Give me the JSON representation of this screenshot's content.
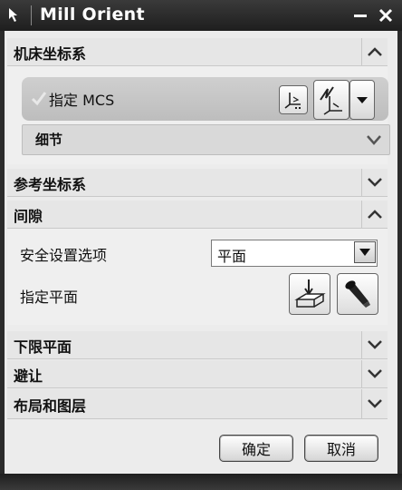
{
  "window": {
    "title": "Mill Orient",
    "icon": "pointer-arrow-icon",
    "controls": {
      "minimize": "minimize-icon",
      "close": "close-icon"
    }
  },
  "sections": {
    "machine_csys": {
      "title": "机床坐标系",
      "state": "expanded",
      "specify_mcs_label": "指定 MCS",
      "detail_label": "细节"
    },
    "reference_csys": {
      "title": "参考坐标系",
      "state": "collapsed"
    },
    "clearance": {
      "title": "间隙",
      "state": "expanded",
      "safety_option_label": "安全设置选项",
      "safety_option_value": "平面",
      "specify_plane_label": "指定平面"
    },
    "lower_plane": {
      "title": "下限平面",
      "state": "collapsed"
    },
    "avoidance": {
      "title": "避让",
      "state": "collapsed"
    },
    "layout_layers": {
      "title": "布局和图层",
      "state": "collapsed"
    }
  },
  "buttons": {
    "ok": "确定",
    "cancel": "取消"
  }
}
